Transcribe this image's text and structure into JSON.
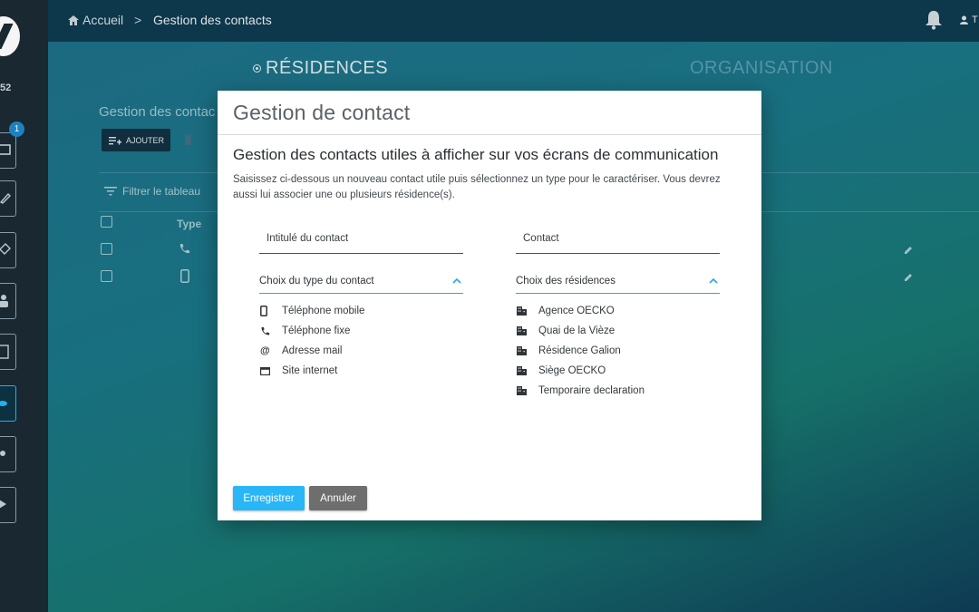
{
  "sidebar": {
    "counter": "52",
    "badge": "1"
  },
  "topbar": {
    "home": "Accueil",
    "separator": ">",
    "page": "Gestion des contacts",
    "user_initial": "T"
  },
  "tabs": [
    {
      "label": "RÉSIDENCES"
    },
    {
      "label": "ORGANISATION"
    }
  ],
  "background": {
    "title": "Gestion des contac",
    "add_label": "AJOUTER",
    "delete_label": "SUPP",
    "filter": "Filtrer le tableau",
    "type_header": "Type"
  },
  "modal": {
    "title": "Gestion de contact",
    "subtitle": "Gestion des contacts utiles à afficher sur vos écrans de communication",
    "description": "Saisissez ci-dessous un nouveau contact utile puis sélectionnez un type pour le caractériser. Vous devrez aussi lui associer une ou plusieurs résidence(s).",
    "field_title": "Intitulé du contact",
    "field_contact": "Contact",
    "type_select": "Choix du type du contact",
    "residence_select": "Choix des résidences",
    "types": [
      {
        "icon": "mobile-phone-icon",
        "label": "Téléphone mobile"
      },
      {
        "icon": "phone-icon",
        "label": "Téléphone fixe"
      },
      {
        "icon": "at-icon",
        "label": "Adresse mail"
      },
      {
        "icon": "web-icon",
        "label": "Site internet"
      }
    ],
    "residences": [
      {
        "icon": "building-icon",
        "label": "Agence OECKO"
      },
      {
        "icon": "building-icon",
        "label": "Quai de la Vièze"
      },
      {
        "icon": "building-icon",
        "label": "Résidence Galion"
      },
      {
        "icon": "building-icon",
        "label": "Siège OECKO"
      },
      {
        "icon": "building-icon",
        "label": "Temporaire declaration"
      }
    ],
    "save_label": "Enregistrer",
    "cancel_label": "Annuler"
  },
  "colors": {
    "accent": "#29b6f6",
    "cancel": "#6e6e6e",
    "sidebar": "#1b2a33",
    "topbar": "#0e3a4e"
  }
}
